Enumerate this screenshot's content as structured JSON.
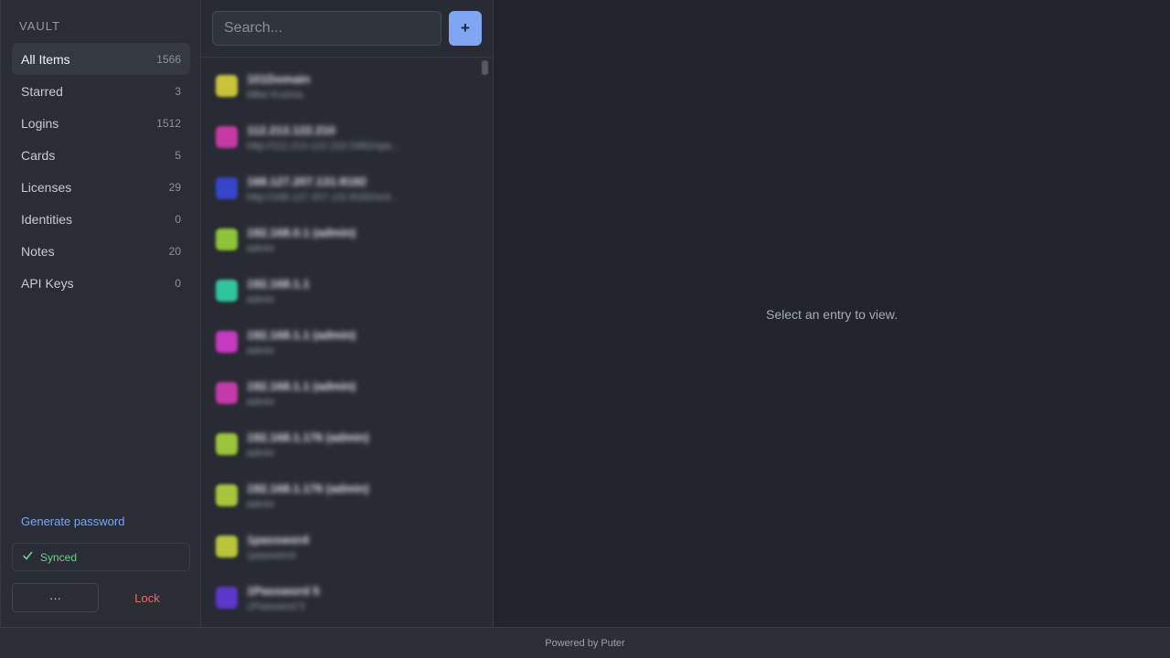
{
  "sidebar": {
    "title": "VAULT",
    "items": [
      {
        "label": "All Items",
        "count": "1566"
      },
      {
        "label": "Starred",
        "count": "3"
      },
      {
        "label": "Logins",
        "count": "1512"
      },
      {
        "label": "Cards",
        "count": "5"
      },
      {
        "label": "Licenses",
        "count": "29"
      },
      {
        "label": "Identities",
        "count": "0"
      },
      {
        "label": "Notes",
        "count": "20"
      },
      {
        "label": "API Keys",
        "count": "0"
      }
    ],
    "generate_password": "Generate password",
    "sync_status": "Synced",
    "sync_icon": "check-icon",
    "more_label": "···",
    "lock_label": "Lock"
  },
  "list": {
    "search_placeholder": "Search...",
    "add_label": "+",
    "entries": [
      {
        "title": "101Domain",
        "subtitle": "Mike Kuoma",
        "color": "#c9c23a"
      },
      {
        "title": "112.213.122.210",
        "subtitle": "http://112.213.122.210:3382/ope...",
        "color": "#c43aa4"
      },
      {
        "title": "168.127.207.131:8182",
        "subtitle": "http://168.127.207.131:8182/ord...",
        "color": "#3844c9"
      },
      {
        "title": "192.168.0.1 (admin)",
        "subtitle": "admin",
        "color": "#8fc43a"
      },
      {
        "title": "192.168.1.1",
        "subtitle": "admin",
        "color": "#2fc4a0"
      },
      {
        "title": "192.168.1.1 (admin)",
        "subtitle": "admin",
        "color": "#c43ac0"
      },
      {
        "title": "192.168.1.1 (admin)",
        "subtitle": "admin",
        "color": "#c43aa8"
      },
      {
        "title": "192.168.1.176 (admin)",
        "subtitle": "admin",
        "color": "#9cc43a"
      },
      {
        "title": "192.168.1.176 (admin)",
        "subtitle": "admin",
        "color": "#a8c43a"
      },
      {
        "title": "1password",
        "subtitle": "1password",
        "color": "#b8c43a"
      },
      {
        "title": "1Password 5",
        "subtitle": "1Password 5",
        "color": "#5a38c9"
      }
    ]
  },
  "detail": {
    "empty_message": "Select an entry to view."
  },
  "footer": {
    "text": "Powered by Puter"
  },
  "colors": {
    "accent": "#7fa6f3",
    "synced": "#6fcf8a",
    "lock": "#ef6a5e",
    "link": "#7da7ef"
  }
}
